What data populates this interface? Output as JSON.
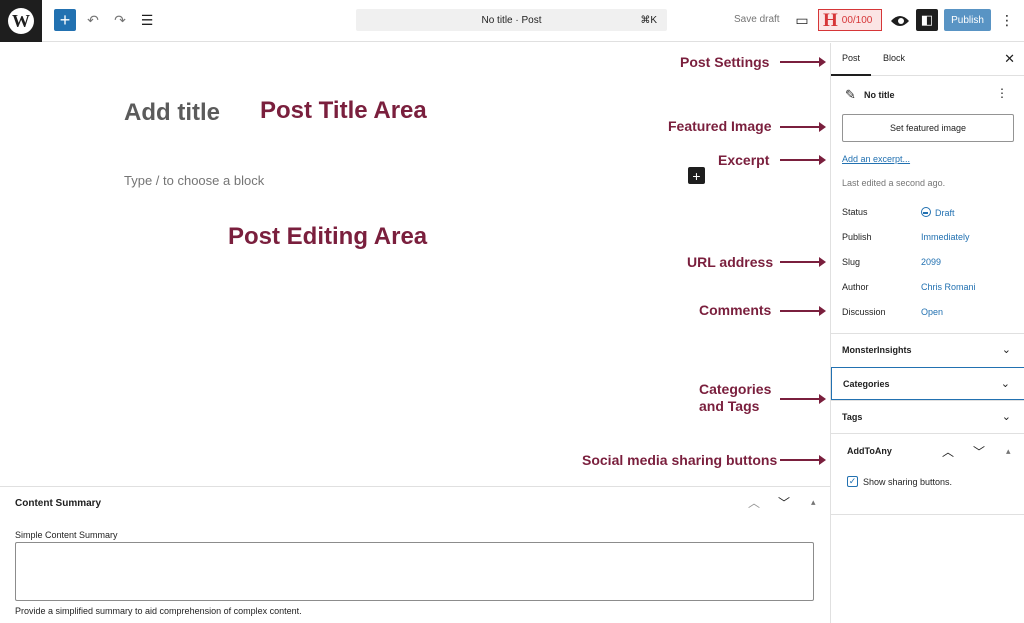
{
  "topbar": {
    "wp_logo_letter": "W",
    "add_label": "+",
    "undo": "↶",
    "redo": "↷",
    "list_view": "☰",
    "command_text": "No title · Post",
    "command_shortcut": "⌘K",
    "save_draft": "Save draft",
    "preview_icon": "▭",
    "headline_letter": "H",
    "headline_score": "00/100",
    "settings_icon": "◧",
    "publish": "Publish",
    "more": "⋮"
  },
  "editor": {
    "title_placeholder": "Add title",
    "block_hint": "Type / to choose a block",
    "add_block": "+"
  },
  "annotations": {
    "title_area": "Post Title Area",
    "editing_area": "Post Editing Area",
    "post_settings": "Post Settings",
    "featured_image": "Featured Image",
    "excerpt": "Excerpt",
    "url_address": "URL address",
    "comments": "Comments",
    "categories_tags_1": "Categories",
    "categories_tags_2": "and Tags",
    "social": "Social media sharing buttons"
  },
  "summary": {
    "title": "Content Summary",
    "label": "Simple Content Summary",
    "help": "Provide a simplified summary to aid comprehension of complex content.",
    "up": "︿",
    "down": "﹀",
    "toggle": "▴"
  },
  "sidebar": {
    "tab_post": "Post",
    "tab_block": "Block",
    "close": "✕",
    "doc_title": "No title",
    "feather": "✎",
    "kebab": "⋮",
    "featured_button": "Set featured image",
    "excerpt_link": "Add an excerpt...",
    "last_edited": "Last edited a second ago.",
    "rows": [
      {
        "label": "Status",
        "value": "Draft"
      },
      {
        "label": "Publish",
        "value": "Immediately"
      },
      {
        "label": "Slug",
        "value": "2099"
      },
      {
        "label": "Author",
        "value": "Chris Romani"
      },
      {
        "label": "Discussion",
        "value": "Open"
      }
    ],
    "panels": {
      "monsterinsights": "MonsterInsights",
      "categories": "Categories",
      "tags": "Tags",
      "chevron": "⌄"
    },
    "addtoany": {
      "title": "AddToAny",
      "up": "︿",
      "down": "﹀",
      "toggle": "▴",
      "check": "✓",
      "show_label": "Show sharing buttons."
    }
  },
  "colors": {
    "accent": "#2271b1",
    "annotation": "#7a1f3d",
    "headline_red": "#d63638"
  }
}
